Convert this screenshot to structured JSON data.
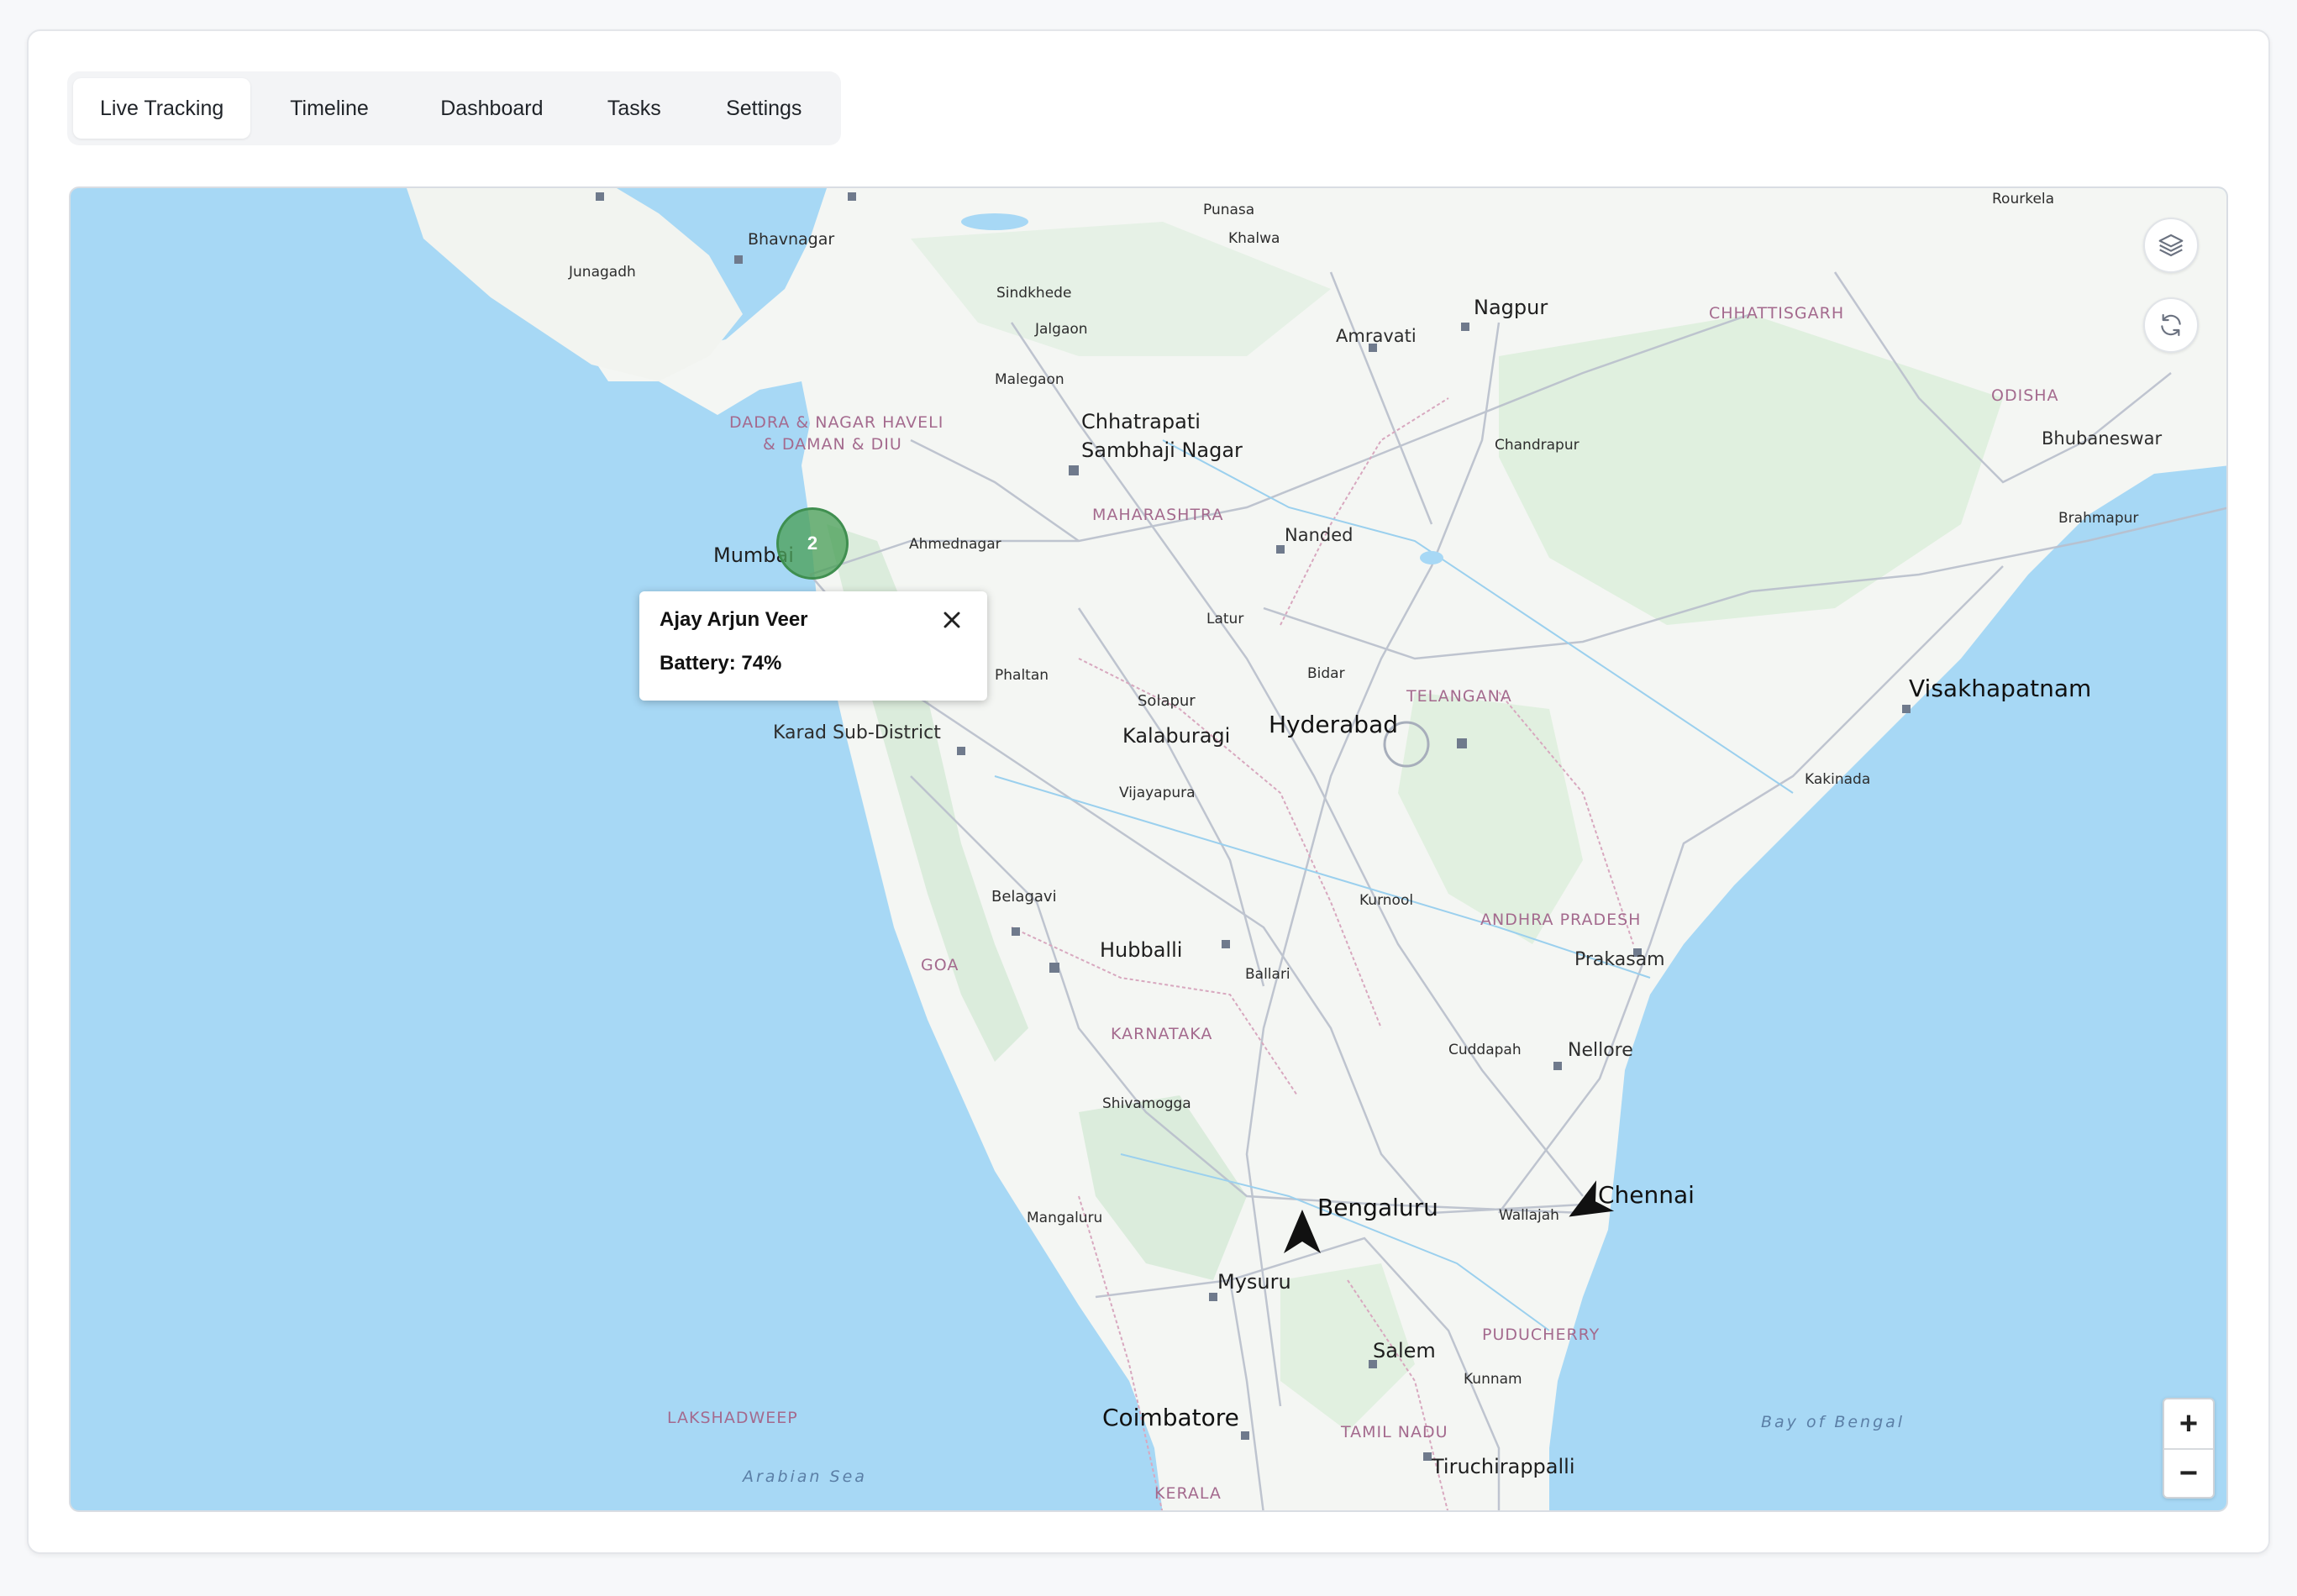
{
  "tabs": [
    {
      "label": "Live Tracking",
      "active": true
    },
    {
      "label": "Timeline",
      "active": false
    },
    {
      "label": "Dashboard",
      "active": false
    },
    {
      "label": "Tasks",
      "active": false
    },
    {
      "label": "Settings",
      "active": false
    }
  ],
  "map": {
    "controls": {
      "layers_icon": "layers-icon",
      "refresh_icon": "refresh-icon",
      "zoom_in": "+",
      "zoom_out": "−"
    },
    "cluster": {
      "count": "2",
      "color": "#4ca05a"
    },
    "popup": {
      "name": "Ajay Arjun Veer",
      "battery": "Battery: 74%"
    },
    "markers": [
      {
        "name": "navigation-arrow-bengaluru"
      },
      {
        "name": "navigation-arrow-chennai"
      }
    ],
    "cities": {
      "bhavnagar": "Bhavnagar",
      "junagadh": "Junagadh",
      "punasa": "Punasa",
      "khalwa": "Khalwa",
      "sindkhede": "Sindkhede",
      "jalgaon": "Jalgaon",
      "malegaon": "Malegaon",
      "nagpur": "Nagpur",
      "amravati": "Amravati",
      "rourkela": "Rourkela",
      "chhatrapati1": "Chhatrapati",
      "chhatrapati2": "Sambhaji Nagar",
      "chandrapur": "Chandrapur",
      "bhubaneswar": "Bhubaneswar",
      "mumbai": "Mumbai",
      "ahmednagar": "Ahmednagar",
      "nanded": "Nanded",
      "brahmapur": "Brahmapur",
      "latur": "Latur",
      "phaltan": "Phaltan",
      "bidar": "Bidar",
      "solapur": "Solapur",
      "hyderabad": "Hyderabad",
      "visakhapatnam": "Visakhapatnam",
      "kalaburagi": "Kalaburagi",
      "karad": "Karad Sub-District",
      "vijayapura": "Vijayapura",
      "kakinada": "Kakinada",
      "belagavi": "Belagavi",
      "kurnool": "Kurnool",
      "hubballi": "Hubballi",
      "prakasam": "Prakasam",
      "ballari": "Ballari",
      "cuddapah": "Cuddapah",
      "nellore": "Nellore",
      "shivamogga": "Shivamogga",
      "bengaluru": "Bengaluru",
      "chennai": "Chennai",
      "wallajah": "Wallajah",
      "mangaluru": "Mangaluru",
      "mysuru": "Mysuru",
      "salem": "Salem",
      "kunnam": "Kunnam",
      "coimbatore": "Coimbatore",
      "tiruchirappalli": "Tiruchirappalli"
    },
    "states": {
      "chhattisgarh": "CHHATTISGARH",
      "odisha": "ODISHA",
      "dadra1": "DADRA & NAGAR HAVELI",
      "dadra2": "& DAMAN & DIU",
      "maharashtra": "MAHARASHTRA",
      "telangana": "TELANGANA",
      "goa": "GOA",
      "andhra": "ANDHRA PRADESH",
      "karnataka": "KARNATAKA",
      "puducherry": "PUDUCHERRY",
      "lakshadweep": "LAKSHADWEEP",
      "tamilnadu": "TAMIL NADU",
      "kerala": "KERALA"
    },
    "seas": {
      "arabian": "Arabian Sea",
      "bengal": "Bay of Bengal"
    }
  }
}
